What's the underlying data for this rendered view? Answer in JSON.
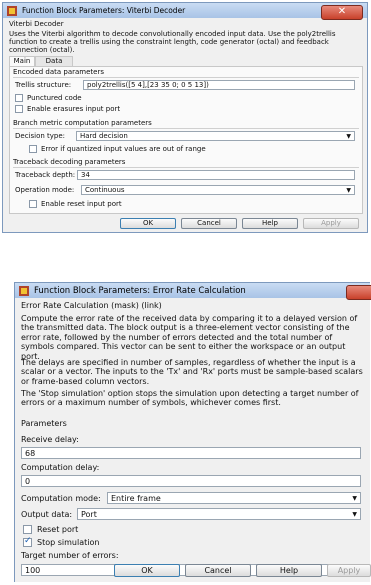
{
  "viterbi": {
    "title": "Function Block Parameters: Viterbi Decoder",
    "block_name": "Viterbi Decoder",
    "description": "Uses the Viterbi algorithm to decode convolutionally encoded input data.  Use the poly2trellis function to create a trellis using the constraint length, code generator (octal) and feedback connection (octal).",
    "tabs": [
      "Main",
      "Data Types"
    ],
    "encoded_group": "Encoded data parameters",
    "trellis_label": "Trellis structure:",
    "trellis_value": "poly2trellis([5 4],[23 35 0; 0 5 13])",
    "punctured_label": "Punctured code",
    "erasures_label": "Enable erasures input port",
    "branch_group": "Branch metric computation parameters",
    "decision_label": "Decision type:",
    "decision_value": "Hard decision",
    "error_out_of_range_label": "Error if quantized input values are out of range",
    "traceback_group": "Traceback decoding parameters",
    "traceback_depth_label": "Traceback depth:",
    "traceback_depth_value": "34",
    "operation_mode_label": "Operation mode:",
    "operation_mode_value": "Continuous",
    "reset_label": "Enable reset input port",
    "buttons": {
      "ok": "OK",
      "cancel": "Cancel",
      "help": "Help",
      "apply": "Apply"
    }
  },
  "error_rate": {
    "title": "Function Block Parameters: Error Rate Calculation",
    "heading": "Error Rate Calculation (mask) (link)",
    "para1": "Compute the error rate of the received data by comparing it to a delayed version of the transmitted data. The block output is a three-element vector consisting of the error rate, followed by the number of errors detected and the total number of symbols compared. This vector can be sent to either the workspace or an output port.",
    "para2": "The delays are specified in number of samples, regardless of whether the input is a scalar or a vector. The inputs to the 'Tx' and 'Rx' ports must be sample-based scalars or frame-based column vectors.",
    "para3": "The 'Stop simulation' option stops the simulation upon detecting a target number of errors or a maximum number of symbols, whichever comes first.",
    "params_heading": "Parameters",
    "receive_delay_label": "Receive delay:",
    "receive_delay_value": "68",
    "computation_delay_label": "Computation delay:",
    "computation_delay_value": "0",
    "computation_mode_label": "Computation mode:",
    "computation_mode_value": "Entire frame",
    "output_data_label": "Output data:",
    "output_data_value": "Port",
    "reset_port_label": "Reset port",
    "stop_simulation_label": "Stop simulation",
    "target_errors_label": "Target number of errors:",
    "target_errors_value": "100",
    "buttons": {
      "ok": "OK",
      "cancel": "Cancel",
      "help": "Help",
      "apply": "Apply"
    }
  }
}
